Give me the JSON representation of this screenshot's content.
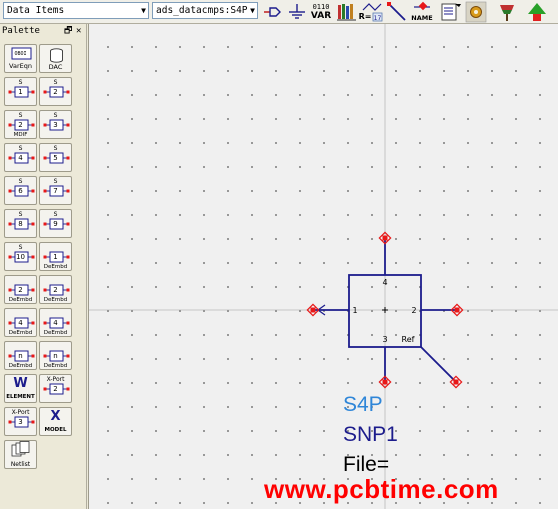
{
  "toolbar": {
    "library_combo": "Data Items",
    "component_combo": "ads_datacmps:S4P",
    "var_top": "0110",
    "var_label": "VAR",
    "r_label": "R=",
    "name_label": "NAME",
    "icons": [
      "port-icon",
      "ground-icon",
      "var-icon",
      "library-icon",
      "wire-label-icon",
      "wire-icon",
      "name-icon",
      "display-icon",
      "gear-icon",
      "flag-icon",
      "arrow-up-icon"
    ]
  },
  "palette": {
    "title": "Palette",
    "items": [
      {
        "top": "OBOI",
        "label": "VarEqn"
      },
      {
        "top": "",
        "label": "DAC"
      },
      {
        "top": "S",
        "num": "1",
        "label": ""
      },
      {
        "top": "S",
        "num": "2",
        "label": ""
      },
      {
        "top": "S",
        "num": "2",
        "label": "MDIF"
      },
      {
        "top": "S",
        "num": "3",
        "label": ""
      },
      {
        "top": "S",
        "num": "4",
        "label": ""
      },
      {
        "top": "S",
        "num": "5",
        "label": ""
      },
      {
        "top": "S",
        "num": "6",
        "label": ""
      },
      {
        "top": "S",
        "num": "7",
        "label": ""
      },
      {
        "top": "S",
        "num": "8",
        "label": ""
      },
      {
        "top": "S",
        "num": "9",
        "label": ""
      },
      {
        "top": "S",
        "num": "10",
        "label": ""
      },
      {
        "top": "",
        "num": "1",
        "label": "DeEmbd"
      },
      {
        "top": "",
        "num": "2",
        "label": "DeEmbd"
      },
      {
        "top": "",
        "num": "2",
        "label": "DeEmbd"
      },
      {
        "top": "",
        "num": "4",
        "label": "DeEmbd"
      },
      {
        "top": "",
        "num": "4",
        "label": "DeEmbd"
      },
      {
        "top": "",
        "num": "n",
        "label": "DeEmbd"
      },
      {
        "top": "",
        "num": "n",
        "label": "DeEmbd"
      },
      {
        "top": "W",
        "label": "ELEMENT"
      },
      {
        "top": "X-Port",
        "num": "2",
        "label": ""
      },
      {
        "top": "X-Port",
        "num": "3",
        "label": ""
      },
      {
        "top": "X",
        "label": "MODEL"
      },
      {
        "top": "",
        "label": "Netlist"
      }
    ]
  },
  "symbol": {
    "pin_top": "4",
    "pin_left": "1",
    "pin_right": "2",
    "pin_bottom": "3",
    "ref_label": "Ref",
    "instance_type": "S4P",
    "instance_name": "SNP1",
    "file_param": "File=",
    "colors": {
      "body": "#1c1c8c",
      "pin": "#e81818",
      "type": "#2f86d8",
      "name": "#1c1c8c",
      "param": "#000000"
    }
  },
  "watermark": "www.pcbtime.com"
}
